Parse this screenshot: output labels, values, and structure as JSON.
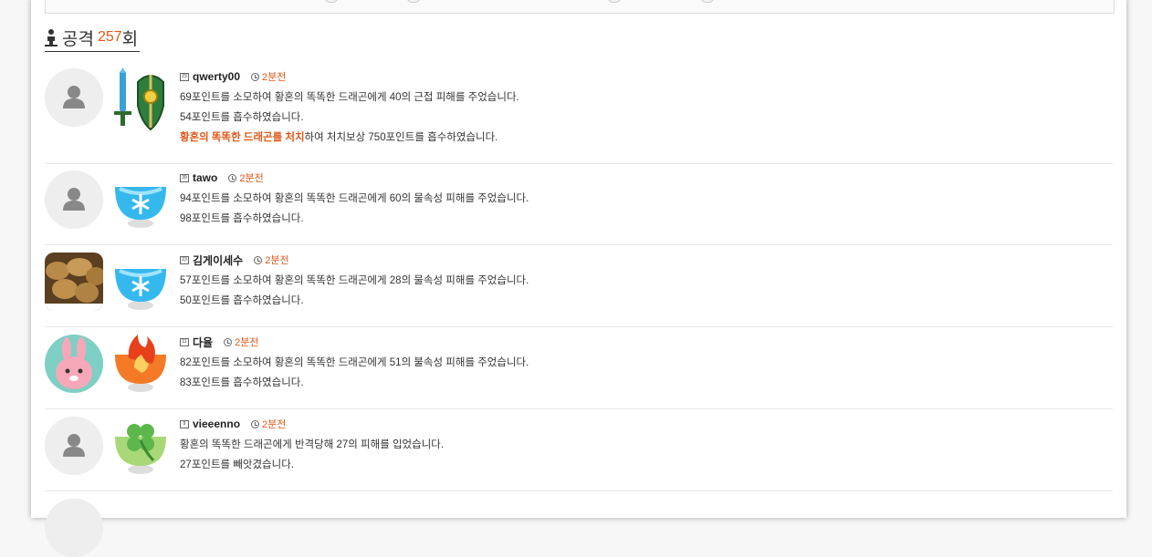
{
  "header": {
    "title": "공격",
    "count": "257",
    "suffix": "회"
  },
  "entries": [
    {
      "level": "23",
      "username": "qwerty00",
      "time": "2분전",
      "avatar": "default-user-icon",
      "item": "sword-and-shield-icon",
      "lines": [
        "69포인트를 소모하여 황혼의 똑똑한 드래곤에게 40의 근접 피해를 주었습니다.",
        "54포인트를 흡수하였습니다."
      ],
      "kill": {
        "highlight": "황혼의 똑똑한 드래곤를 처치",
        "rest": "하여 처치보상 750포인트를 흡수하였습니다."
      }
    },
    {
      "level": "39",
      "username": "tawo",
      "time": "2분전",
      "avatar": "default-user-icon",
      "item": "ice-orb-icon",
      "lines": [
        "94포인트를 소모하여 황혼의 똑똑한 드래곤에게 60의 물속성 피해를 주었습니다.",
        "98포인트를 흡수하였습니다."
      ]
    },
    {
      "level": "23",
      "username": "김게이세수",
      "time": "2분전",
      "avatar": "potato-avatar",
      "item": "ice-orb-icon",
      "lines": [
        "57포인트를 소모하여 황혼의 똑똑한 드래곤에게 28의 물속성 피해를 주었습니다.",
        "50포인트를 흡수하였습니다."
      ]
    },
    {
      "level": "11",
      "username": "다율",
      "time": "2분전",
      "avatar": "pink-bunny-avatar",
      "item": "fire-orb-icon",
      "lines": [
        "82포인트를 소모하여 황혼의 똑똑한 드래곤에게 51의 불속성 피해를 주었습니다.",
        "83포인트를 흡수하였습니다."
      ]
    },
    {
      "level": "9",
      "username": "vieeenno",
      "time": "2분전",
      "avatar": "default-user-icon",
      "item": "clover-orb-icon",
      "lines": [
        "황혼의 똑똑한 드래곤에게 반격당해 27의 피해를 입었습니다.",
        "27포인트를 빼앗겼습니다."
      ]
    }
  ],
  "colors": {
    "accent": "#e0581a",
    "text": "#333333",
    "divider": "#e8e8e8"
  }
}
